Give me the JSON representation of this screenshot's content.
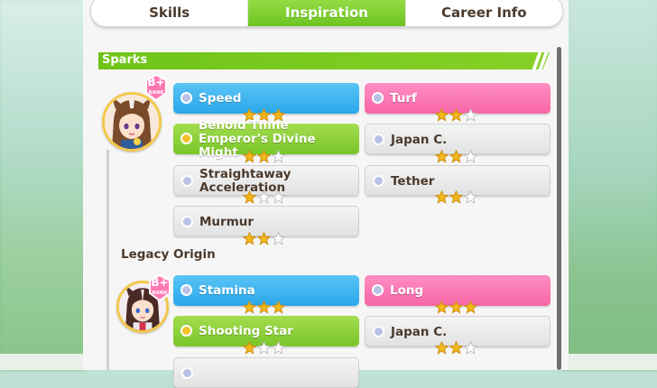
{
  "tabs": [
    {
      "label": "Skills",
      "active": false
    },
    {
      "label": "Inspiration",
      "active": true
    },
    {
      "label": "Career Info",
      "active": false
    }
  ],
  "sparks_header": "Sparks",
  "legacy_header": "Legacy Origin",
  "rank_badge_text": "RANK",
  "rank_badge_grade": "B+",
  "colors": {
    "accent_green": "#6fc417",
    "blue": "#2aa7ea",
    "pink": "#f665a6",
    "star": "#f2b71a"
  },
  "main_sparks": [
    {
      "name": "Speed",
      "type": "stat",
      "color": "blue",
      "stars": 3
    },
    {
      "name": "Turf",
      "type": "stat",
      "color": "pink",
      "stars": 2
    },
    {
      "name": "Behold Thine Emperor's Divine Might",
      "type": "unique",
      "color": "green",
      "stars": 2
    },
    {
      "name": "Japan C.",
      "type": "race",
      "color": "grey",
      "stars": 2
    },
    {
      "name": "Straightaway Acceleration",
      "type": "skill",
      "color": "grey",
      "stars": 1
    },
    {
      "name": "Tether",
      "type": "skill",
      "color": "grey",
      "stars": 2
    },
    {
      "name": "Murmur",
      "type": "skill",
      "color": "grey",
      "stars": 2
    }
  ],
  "legacy_sparks": [
    {
      "name": "Stamina",
      "type": "stat",
      "color": "blue",
      "stars": 3
    },
    {
      "name": "Long",
      "type": "stat",
      "color": "pink",
      "stars": 3
    },
    {
      "name": "Shooting Star",
      "type": "unique",
      "color": "green",
      "stars": 1
    },
    {
      "name": "Japan C.",
      "type": "race",
      "color": "grey",
      "stars": 2
    }
  ]
}
